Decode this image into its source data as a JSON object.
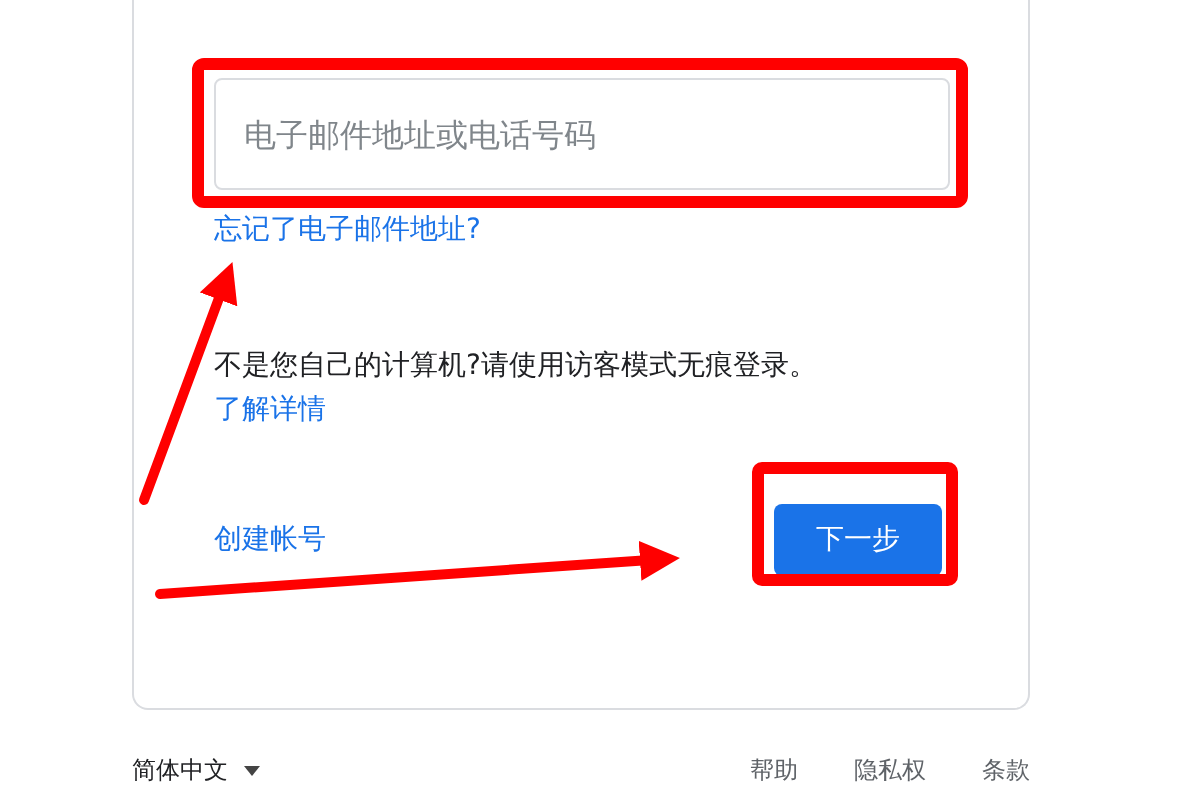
{
  "email_field": {
    "placeholder": "电子邮件地址或电话号码"
  },
  "forgot_link": "忘记了电子邮件地址?",
  "guest_notice": "不是您自己的计算机?请使用访客模式无痕登录。",
  "learn_more_link": "了解详情",
  "create_account_link": "创建帐号",
  "next_button": "下一步",
  "footer": {
    "language": "简体中文",
    "links": [
      "帮助",
      "隐私权",
      "条款"
    ]
  }
}
